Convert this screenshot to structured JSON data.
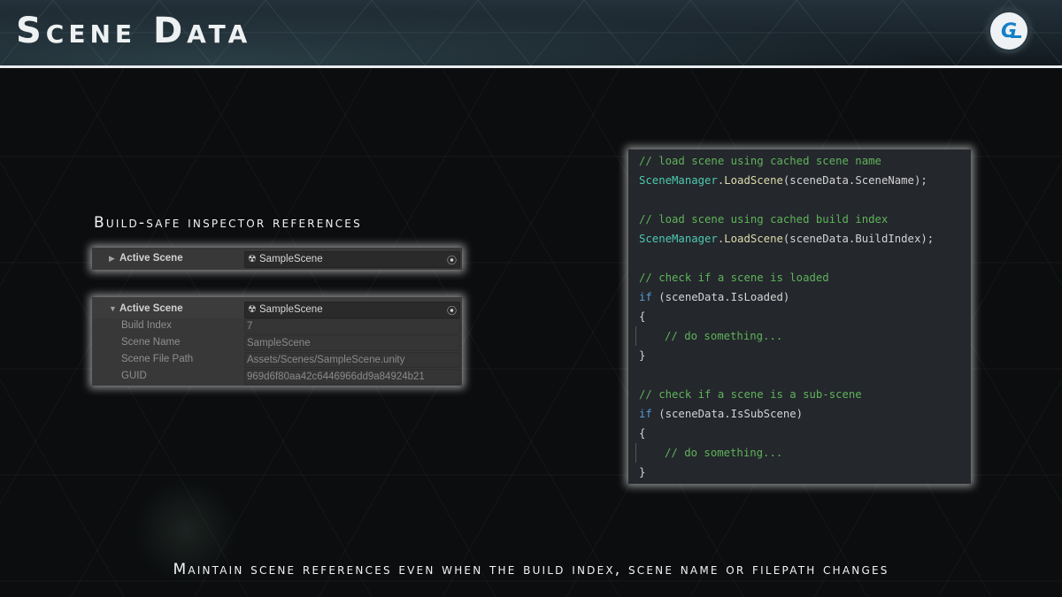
{
  "header": {
    "title": "Scene Data",
    "logo_text": "G"
  },
  "subheading": "Build-safe inspector references",
  "inspector_collapsed": {
    "label": "Active Scene",
    "scene_value": "SampleScene"
  },
  "inspector_expanded": {
    "label": "Active Scene",
    "scene_value": "SampleScene",
    "fields": [
      {
        "label": "Build Index",
        "value": "7"
      },
      {
        "label": "Scene Name",
        "value": "SampleScene"
      },
      {
        "label": "Scene File Path",
        "value": "Assets/Scenes/SampleScene.unity"
      },
      {
        "label": "GUID",
        "value": "969d6f80aa42c6446966dd9a84924b21"
      }
    ]
  },
  "code": {
    "comment1": "// load scene using cached scene name",
    "line1_type": "SceneManager",
    "line1_fn": "LoadScene",
    "line1_arg": "(sceneData.SceneName);",
    "comment2": "// load scene using cached build index",
    "line2_type": "SceneManager",
    "line2_fn": "LoadScene",
    "line2_arg": "(sceneData.BuildIndex);",
    "comment3": "// check if a scene is loaded",
    "if1_kw": "if",
    "if1_cond": " (sceneData.IsLoaded)",
    "brace_open": "{",
    "body1": "// do something...",
    "brace_close": "}",
    "comment4": "// check if a scene is a sub-scene",
    "if2_kw": "if",
    "if2_cond": " (sceneData.IsSubScene)",
    "body2": "// do something..."
  },
  "footer": "Maintain scene references even when the build index, scene name or filepath changes",
  "colors": {
    "comment": "#5fb35a",
    "type": "#4ec9b0",
    "keyword": "#569cd6",
    "logo_blue": "#1580c8"
  }
}
